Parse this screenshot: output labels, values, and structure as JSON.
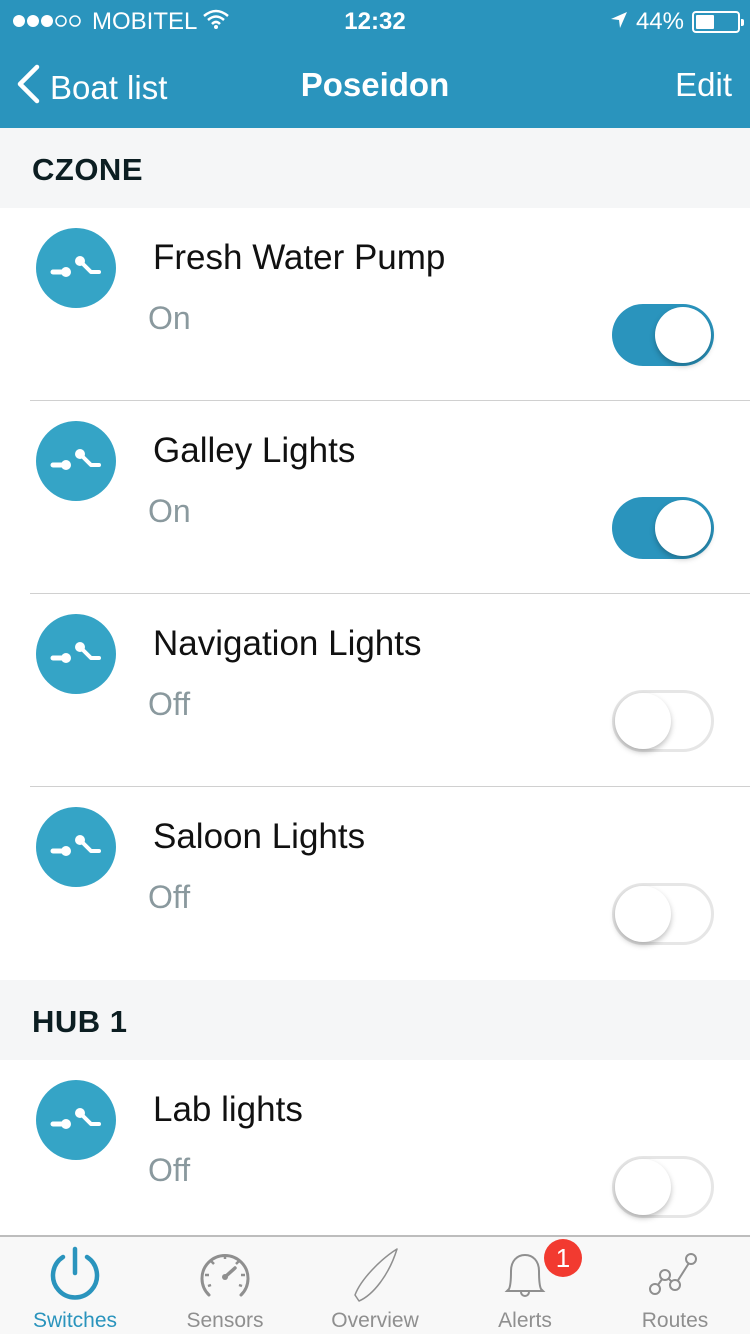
{
  "status_bar": {
    "carrier": "MOBITEL",
    "signal_bars_filled": 3,
    "signal_bars_total": 5,
    "time": "12:32",
    "battery_percent": "44%",
    "battery_level": 0.44
  },
  "nav": {
    "back_label": "Boat list",
    "title": "Poseidon",
    "edit_label": "Edit"
  },
  "sections": [
    {
      "title": "CZONE",
      "items": [
        {
          "name": "Fresh Water Pump",
          "state": "On",
          "on": true
        },
        {
          "name": "Galley Lights",
          "state": "On",
          "on": true
        },
        {
          "name": "Navigation Lights",
          "state": "Off",
          "on": false
        },
        {
          "name": "Saloon Lights",
          "state": "Off",
          "on": false
        }
      ]
    },
    {
      "title": "HUB 1",
      "items": [
        {
          "name": "Lab lights",
          "state": "Off",
          "on": false
        }
      ]
    }
  ],
  "tabbar": {
    "tabs": [
      {
        "label": "Switches",
        "icon": "power-icon",
        "active": true
      },
      {
        "label": "Sensors",
        "icon": "gauge-icon",
        "active": false
      },
      {
        "label": "Overview",
        "icon": "boat-icon",
        "active": false
      },
      {
        "label": "Alerts",
        "icon": "bell-icon",
        "active": false
      },
      {
        "label": "Routes",
        "icon": "route-icon",
        "active": false
      }
    ],
    "alerts_badge": "1"
  },
  "colors": {
    "accent": "#2a94bd",
    "icon_bg": "#35a4c6",
    "badge": "#f23a30"
  }
}
